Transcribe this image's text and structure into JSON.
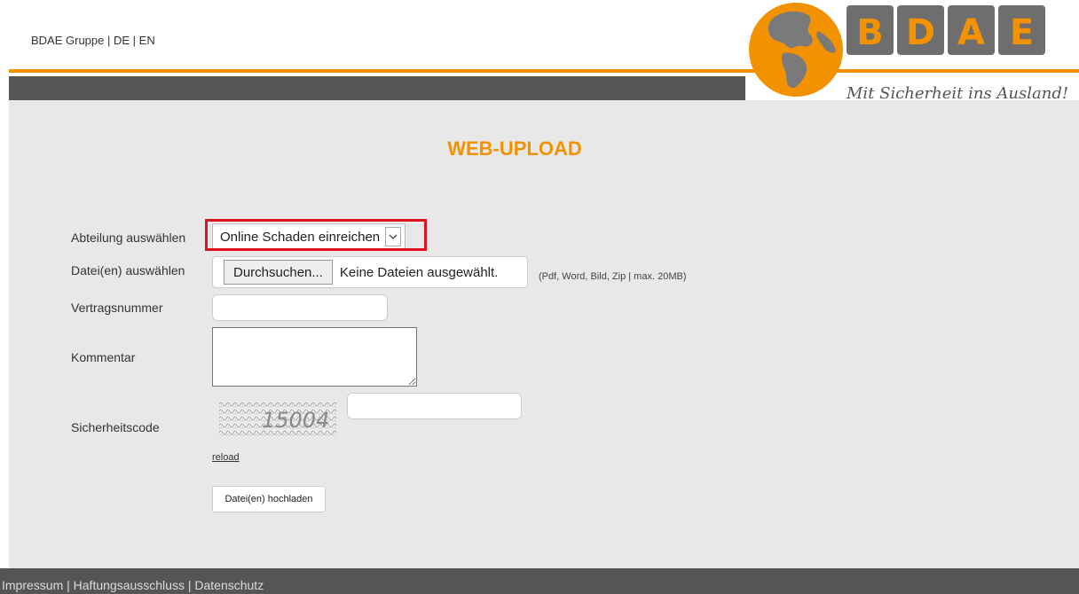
{
  "header": {
    "nav": {
      "brand": "BDAE Gruppe",
      "sep1": " | ",
      "de": "DE",
      "sep2": " | ",
      "en": "EN"
    },
    "logo": {
      "letters": [
        "B",
        "D",
        "A",
        "E"
      ],
      "slogan": "Mit Sicherheit ins Ausland!"
    }
  },
  "page": {
    "title": "WEB-UPLOAD"
  },
  "form": {
    "department": {
      "label": "Abteilung auswählen",
      "value": "Online Schaden einreichen"
    },
    "files": {
      "label": "Datei(en) auswählen",
      "button": "Durchsuchen...",
      "status": "Keine Dateien ausgewählt.",
      "hint": "(Pdf, Word, Bild, Zip | max. 20MB)"
    },
    "contract": {
      "label": "Vertragsnummer",
      "value": ""
    },
    "comment": {
      "label": "Kommentar",
      "value": ""
    },
    "security": {
      "label": "Sicherheitscode",
      "captcha_text": "15004",
      "value": "",
      "reload": "reload"
    },
    "submit": "Datei(en) hochladen"
  },
  "footer": {
    "impressum": "Impressum",
    "sep1": " | ",
    "haftung": "Haftungsausschluss",
    "sep2": " | ",
    "datenschutz": "Datenschutz"
  },
  "colors": {
    "accent": "#f39200",
    "dark_bar": "#555555",
    "highlight": "#e0121d",
    "content_bg": "#e8e8e8",
    "logo_tile": "#6e6e6e"
  }
}
